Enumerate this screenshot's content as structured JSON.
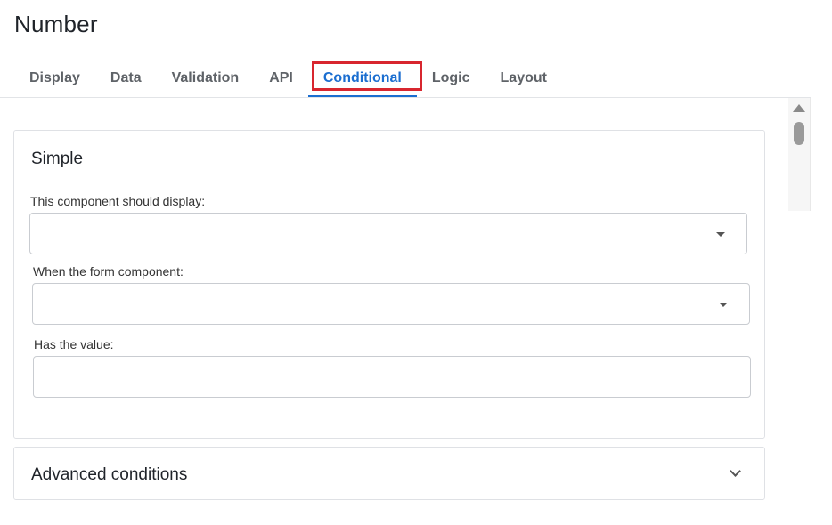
{
  "header": {
    "title": "Number"
  },
  "tabs": [
    {
      "label": "Display"
    },
    {
      "label": "Data"
    },
    {
      "label": "Validation"
    },
    {
      "label": "API"
    },
    {
      "label": "Conditional",
      "active": true
    },
    {
      "label": "Logic"
    },
    {
      "label": "Layout"
    }
  ],
  "simple": {
    "heading": "Simple",
    "display_label": "This component should display:",
    "display_value": "",
    "component_label": "When the form component:",
    "component_value": "",
    "value_label": "Has the value:",
    "value_value": ""
  },
  "advanced": {
    "heading": "Advanced conditions"
  },
  "colors": {
    "accent": "#1b6ed0",
    "highlight": "#d8262f"
  }
}
